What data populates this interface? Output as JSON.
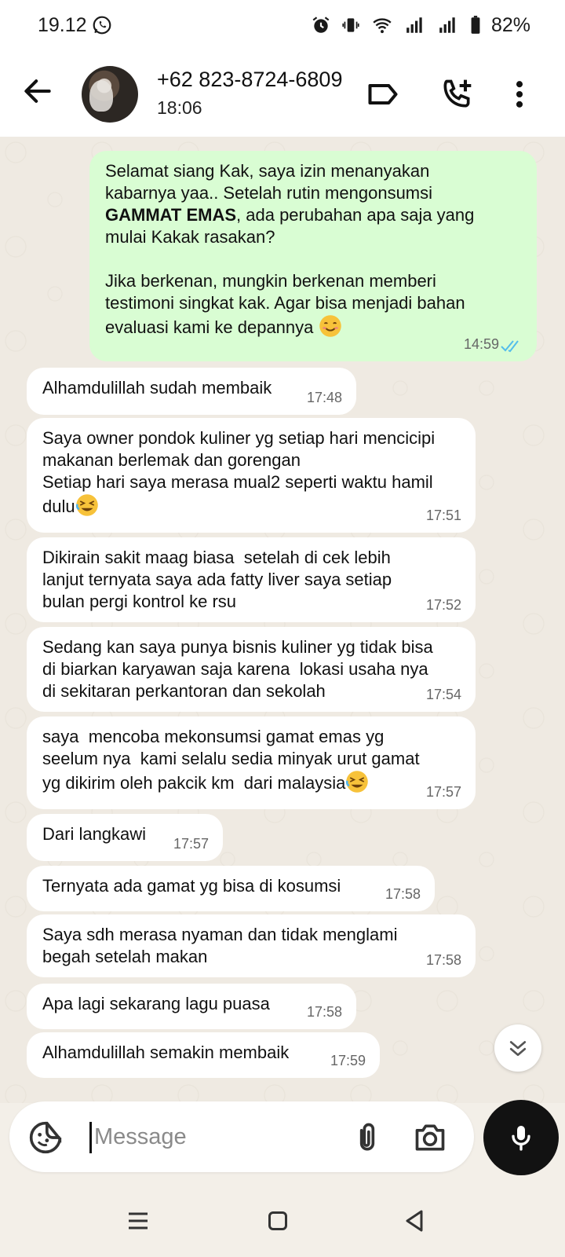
{
  "status_bar": {
    "time": "19.12",
    "battery": "82%",
    "icons": [
      "whatsapp-icon",
      "alarm-icon",
      "vibrate-icon",
      "wifi-icon",
      "signal-icon",
      "signal-icon",
      "battery-icon"
    ]
  },
  "header": {
    "contact_name": "+62 823-8724-6809",
    "subtitle": "18:06",
    "icons": [
      "back-arrow-icon",
      "label-icon",
      "add-call-icon",
      "more-vertical-icon"
    ]
  },
  "messages": [
    {
      "direction": "out",
      "parts": [
        {
          "text": "Selamat siang Kak, saya izin menanyakan\nkabarnya yaa.. Setelah rutin mengonsumsi\n",
          "bold": false
        },
        {
          "text": "GAMMAT EMAS",
          "bold": true
        },
        {
          "text": ", ada perubahan apa saja yang\nmulai Kakak rasakan?\n\nJika berkenan, mungkin berkenan memberi\ntestimoni singkat kak. Agar bisa menjadi bahan\nevaluasi kami ke depannya ",
          "bold": false
        }
      ],
      "emoji": "smiling-face-emoji",
      "time": "14:59",
      "status": "read"
    },
    {
      "direction": "in",
      "text": "Alhamdulillah sudah membaik",
      "time": "17:48"
    },
    {
      "direction": "in",
      "text": "Saya owner pondok kuliner yg setiap hari mencicipi\nmakanan berlemak dan gorengan\nSetiap hari saya merasa mual2 seperti waktu hamil\ndulu",
      "emoji": "rolling-laughing-emoji",
      "time": "17:51"
    },
    {
      "direction": "in",
      "text": "Dikirain sakit maag biasa  setelah di cek lebih\nlanjut ternyata saya ada fatty liver saya setiap\nbulan pergi kontrol ke rsu",
      "time": "17:52"
    },
    {
      "direction": "in",
      "text": "Sedang kan saya punya bisnis kuliner yg tidak bisa\ndi biarkan karyawan saja karena  lokasi usaha nya\ndi sekitaran perkantoran dan sekolah",
      "time": "17:54"
    },
    {
      "direction": "in",
      "text": "saya  mencoba mekonsumsi gamat emas yg\nseelum nya  kami selalu sedia minyak urut gamat\nyg dikirim oleh pakcik km  dari malaysia",
      "emoji": "rolling-laughing-emoji",
      "time": "17:57"
    },
    {
      "direction": "in",
      "text": "Dari langkawi",
      "time": "17:57"
    },
    {
      "direction": "in",
      "text": "Ternyata ada gamat yg bisa di kosumsi",
      "time": "17:58"
    },
    {
      "direction": "in",
      "text": "Saya sdh merasa nyaman dan tidak menglami\nbegah setelah makan",
      "time": "17:58"
    },
    {
      "direction": "in",
      "text": "Apa lagi sekarang lagu puasa",
      "time": "17:58"
    },
    {
      "direction": "in",
      "text": "Alhamdulillah semakin membaik",
      "time": "17:59"
    }
  ],
  "composer": {
    "placeholder": "Message",
    "icons": [
      "sticker-icon",
      "attach-icon",
      "camera-icon",
      "mic-icon"
    ]
  },
  "nav": {
    "icons": [
      "menu-icon",
      "home-icon",
      "back-icon"
    ]
  },
  "colors": {
    "outgoing_bubble": "#d9fdd3",
    "incoming_bubble": "#ffffff",
    "read_ticks": "#53bdeb",
    "mic_button": "#121212"
  }
}
